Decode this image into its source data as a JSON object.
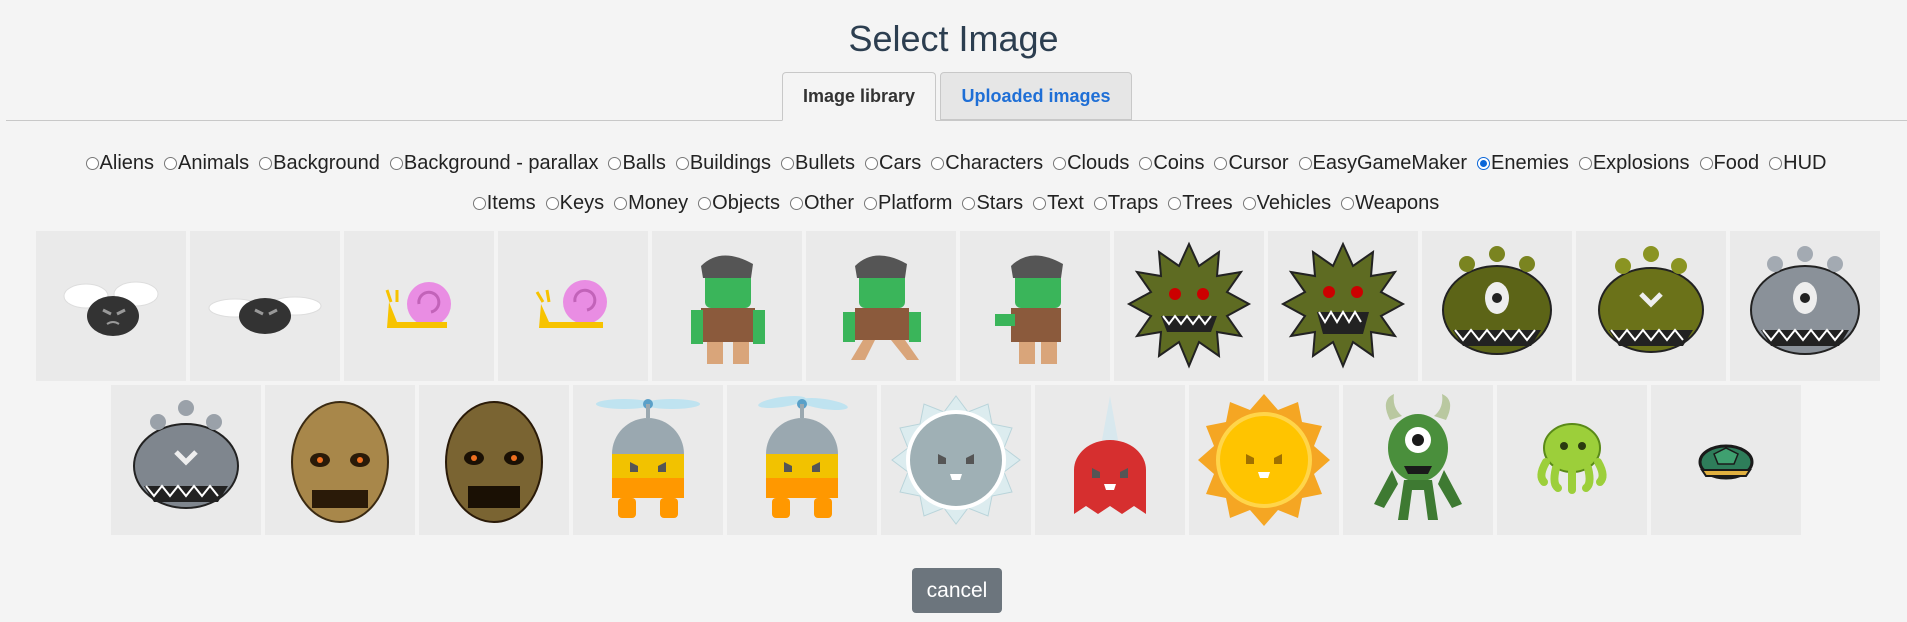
{
  "dialog": {
    "title": "Select Image"
  },
  "tabs": [
    {
      "label": "Image library",
      "active": true
    },
    {
      "label": "Uploaded images",
      "active": false
    }
  ],
  "categories_row1": [
    "Aliens",
    "Animals",
    "Background",
    "Background - parallax",
    "Balls",
    "Buildings",
    "Bullets",
    "Cars",
    "Characters",
    "Clouds",
    "Coins",
    "Cursor",
    "EasyGameMaker",
    "Enemies",
    "Explosions",
    "Food",
    "HUD"
  ],
  "categories_row2": [
    "Items",
    "Keys",
    "Money",
    "Objects",
    "Other",
    "Platform",
    "Stars",
    "Text",
    "Traps",
    "Trees",
    "Vehicles",
    "Weapons"
  ],
  "selected_category": "Enemies",
  "images_row1": [
    "fly-enemy",
    "fly-enemy-flying",
    "snail-enemy",
    "snail-enemy-walk",
    "zombie-enemy",
    "zombie-enemy-walk",
    "zombie-enemy-attack",
    "spiky-monster",
    "spiky-monster-angry",
    "beholder-green",
    "beholder-green-alt",
    "beholder-grey"
  ],
  "images_row2": [
    "beholder-grey-alt",
    "rock-face-monster",
    "rock-face-monster-dark",
    "propeller-enemy-yellow",
    "propeller-enemy-yellow-alt",
    "spikeball-blue",
    "spike-top-red",
    "sun-enemy",
    "cyclops-horned",
    "octopus-green",
    "turtle-shell"
  ],
  "buttons": {
    "cancel": "cancel"
  },
  "colors": {
    "link_blue": "#1f6fd6",
    "radio_checked": "#0a66d8",
    "cancel_bg": "#6c757d"
  }
}
